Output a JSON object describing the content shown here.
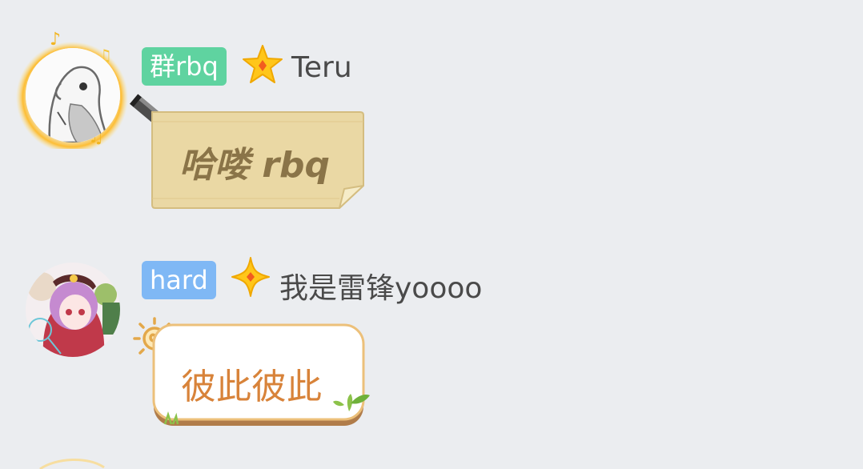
{
  "messages": [
    {
      "tag": "群rbq",
      "tag_color": "#5fd3a0",
      "username": "Teru",
      "text": "哈喽 rbq",
      "bubble_style": "paper-note",
      "avatar": "parrot-avatar",
      "badge_icon": "gold-star-icon"
    },
    {
      "tag": "hard",
      "tag_color": "#7fb8f5",
      "username": "我是雷锋yoooo",
      "text": "彼此彼此",
      "bubble_style": "sun-sprout",
      "avatar": "anime-girl-avatar",
      "badge_icon": "gold-diamond-star-icon"
    }
  ]
}
